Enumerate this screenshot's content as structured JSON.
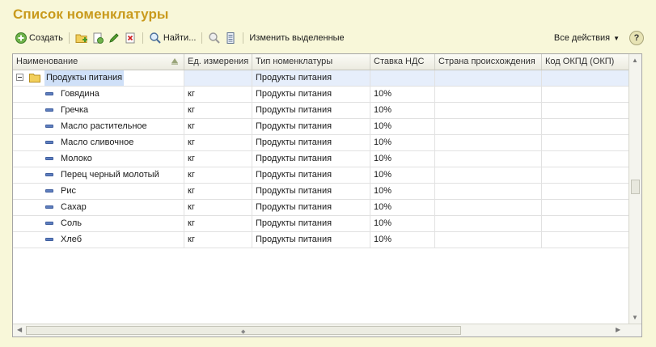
{
  "window": {
    "title": "Список номенклатуры"
  },
  "toolbar": {
    "create_label": "Создать",
    "find_label": "Найти...",
    "edit_selected_label": "Изменить выделенные",
    "all_actions_label": "Все действия",
    "help_label": "?"
  },
  "table": {
    "columns": [
      "Наименование",
      "Ед. измерения",
      "Тип номенклатуры",
      "Ставка НДС",
      "Страна происхождения",
      "Код ОКПД (ОКП)"
    ],
    "group": {
      "name": "Продукты питания",
      "unit": "",
      "type": "Продукты питания",
      "vat": "",
      "country": "",
      "code": ""
    },
    "rows": [
      {
        "name": "Говядина",
        "unit": "кг",
        "type": "Продукты питания",
        "vat": "10%",
        "country": "",
        "code": ""
      },
      {
        "name": "Гречка",
        "unit": "кг",
        "type": "Продукты питания",
        "vat": "10%",
        "country": "",
        "code": ""
      },
      {
        "name": "Масло растительное",
        "unit": "кг",
        "type": "Продукты питания",
        "vat": "10%",
        "country": "",
        "code": ""
      },
      {
        "name": "Масло сливочное",
        "unit": "кг",
        "type": "Продукты питания",
        "vat": "10%",
        "country": "",
        "code": ""
      },
      {
        "name": "Молоко",
        "unit": "кг",
        "type": "Продукты питания",
        "vat": "10%",
        "country": "",
        "code": ""
      },
      {
        "name": "Перец черный молотый",
        "unit": "кг",
        "type": "Продукты питания",
        "vat": "10%",
        "country": "",
        "code": ""
      },
      {
        "name": "Рис",
        "unit": "кг",
        "type": "Продукты питания",
        "vat": "10%",
        "country": "",
        "code": ""
      },
      {
        "name": "Сахар",
        "unit": "кг",
        "type": "Продукты питания",
        "vat": "10%",
        "country": "",
        "code": ""
      },
      {
        "name": "Соль",
        "unit": "кг",
        "type": "Продукты питания",
        "vat": "10%",
        "country": "",
        "code": ""
      },
      {
        "name": "Хлеб",
        "unit": "кг",
        "type": "Продукты питания",
        "vat": "10%",
        "country": "",
        "code": ""
      }
    ]
  },
  "colors": {
    "title": "#c99a1c",
    "background": "#f8f7d9",
    "group_row": "#e6eefb",
    "group_label": "#cfe0f8"
  }
}
